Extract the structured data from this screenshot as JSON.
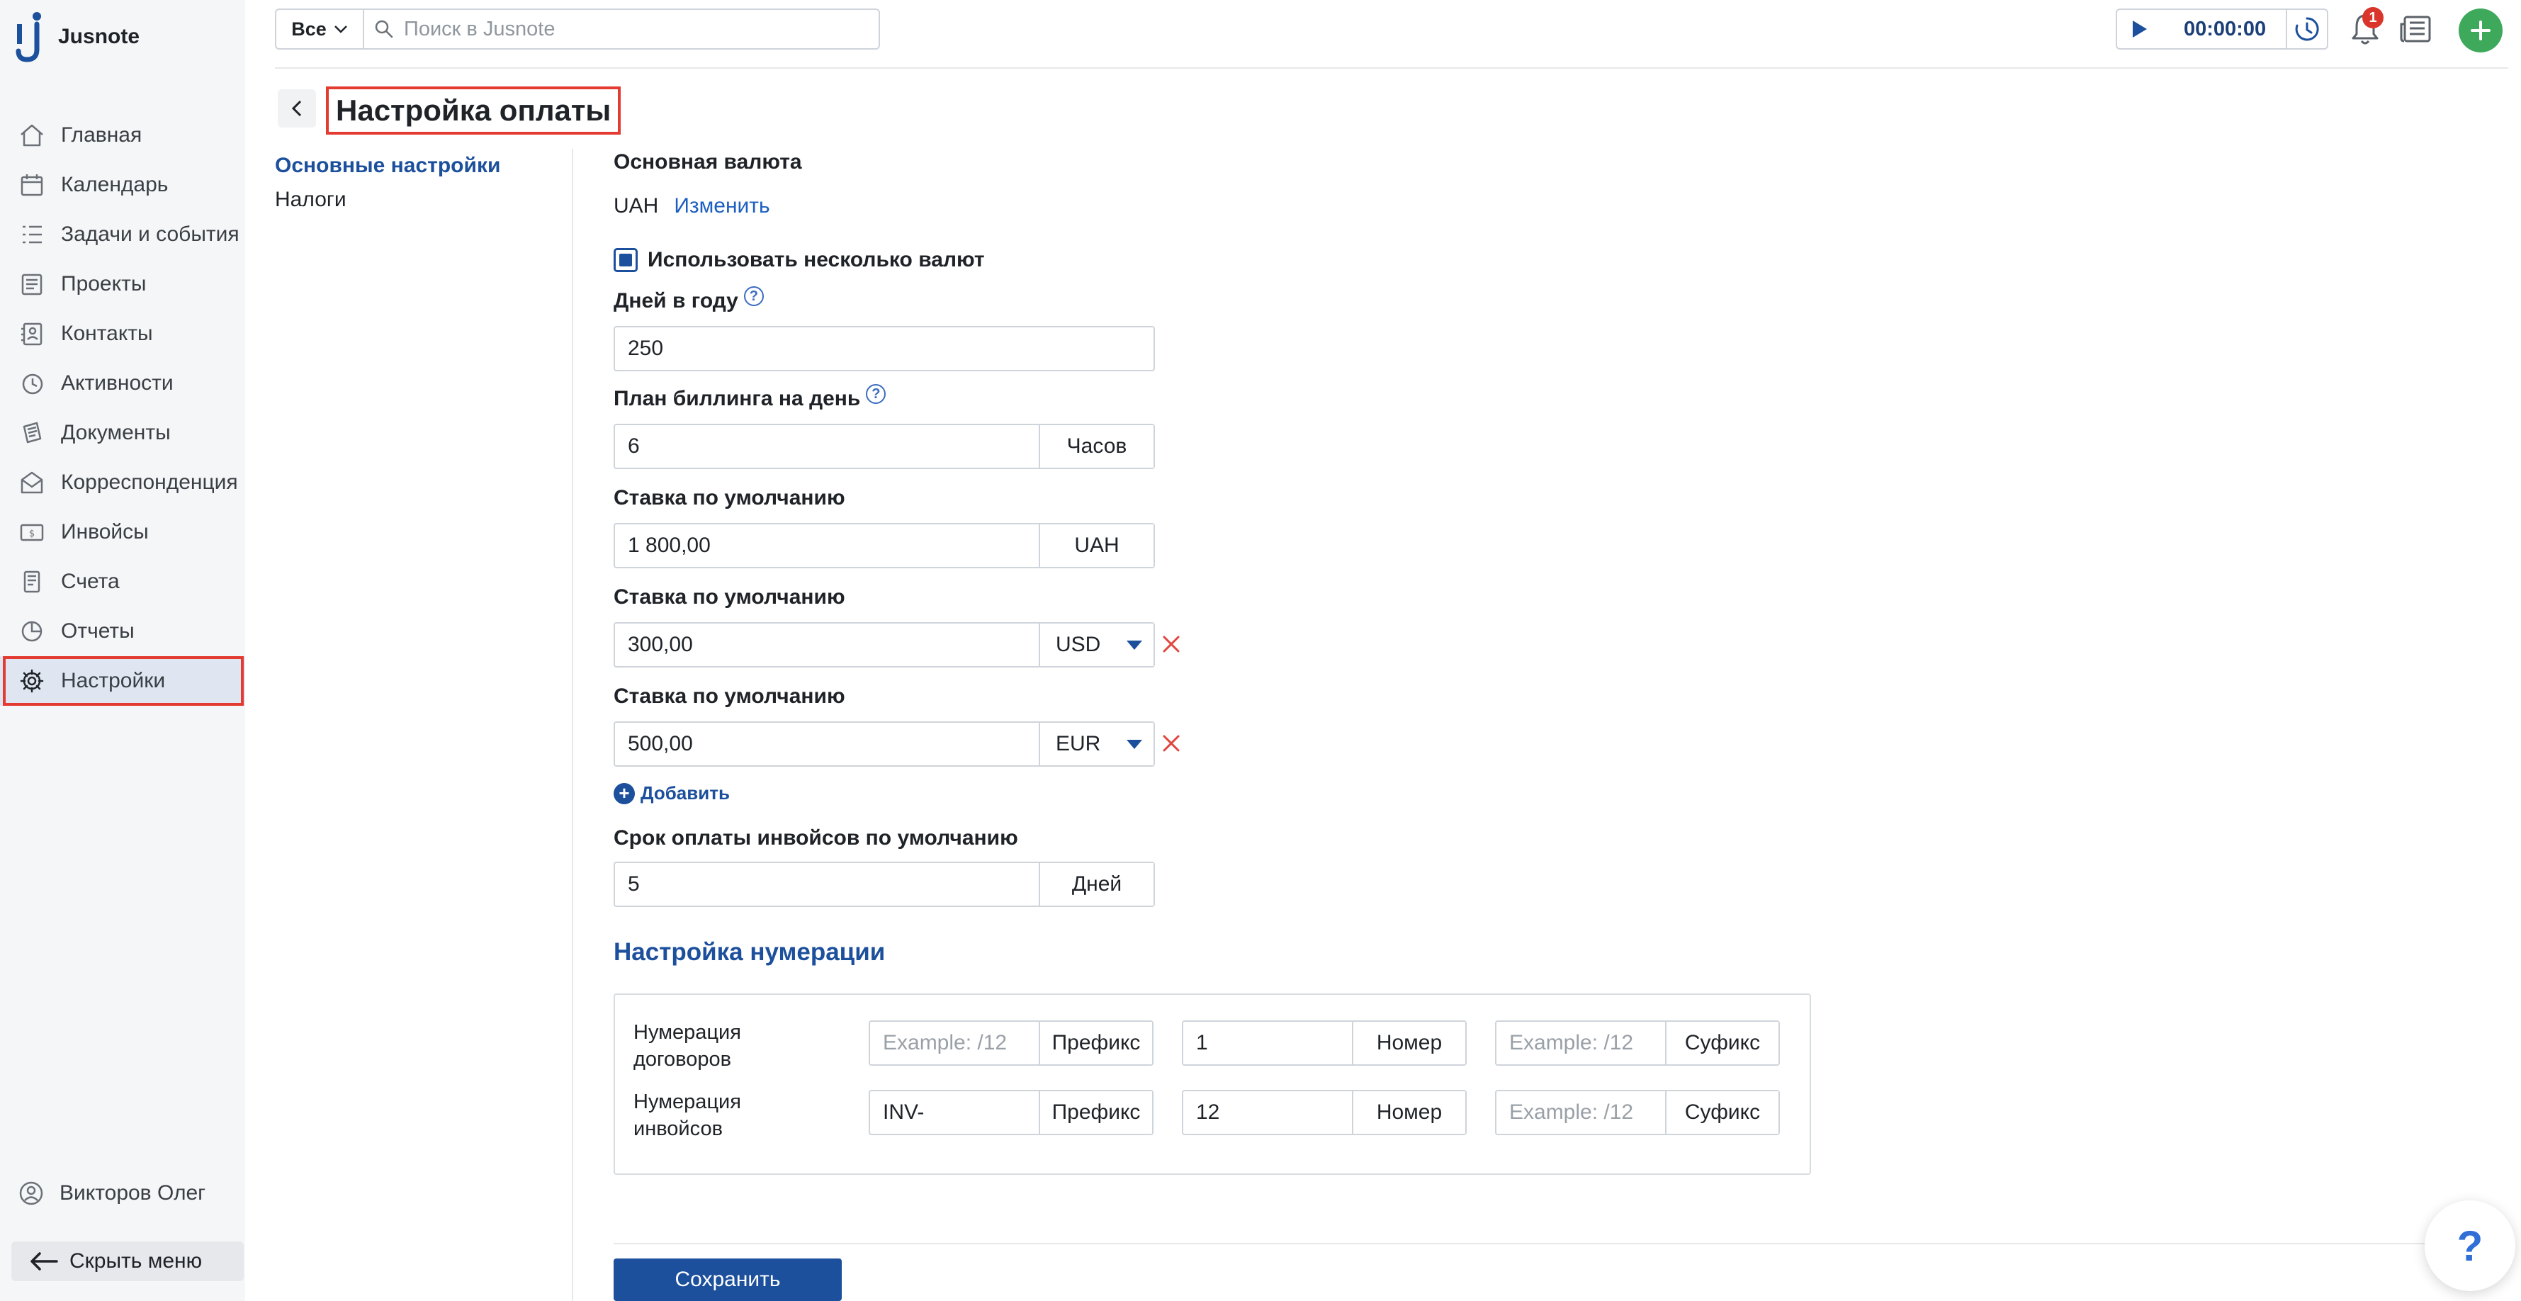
{
  "app": {
    "logo_text": "Jusnote"
  },
  "sidebar": {
    "items": [
      {
        "label": "Главная",
        "icon": "home-icon"
      },
      {
        "label": "Календарь",
        "icon": "calendar-icon"
      },
      {
        "label": "Задачи и события",
        "icon": "tasks-icon"
      },
      {
        "label": "Проекты",
        "icon": "projects-icon"
      },
      {
        "label": "Контакты",
        "icon": "contacts-icon"
      },
      {
        "label": "Активности",
        "icon": "activity-icon"
      },
      {
        "label": "Документы",
        "icon": "documents-icon"
      },
      {
        "label": "Корреспонденция",
        "icon": "mail-icon"
      },
      {
        "label": "Инвойсы",
        "icon": "invoice-icon"
      },
      {
        "label": "Счета",
        "icon": "bills-icon"
      },
      {
        "label": "Отчеты",
        "icon": "reports-icon"
      },
      {
        "label": "Настройки",
        "icon": "settings-icon"
      }
    ],
    "active_index": 11,
    "user_name": "Викторов Олег",
    "hide_menu_label": "Скрыть меню"
  },
  "topbar": {
    "scope_label": "Все",
    "search_placeholder": "Поиск в Jusnote",
    "timer_value": "00:00:00",
    "notification_count": "1"
  },
  "page": {
    "title": "Настройка оплаты",
    "subnav": [
      "Основные настройки",
      "Налоги"
    ],
    "subnav_active": 0
  },
  "form": {
    "base_currency_label": "Основная валюта",
    "base_currency_value": "UAH",
    "change_link": "Изменить",
    "multi_currency_label": "Использовать несколько валют",
    "multi_currency_checked": true,
    "days_per_year_label": "Дней в году",
    "days_per_year_value": "250",
    "billing_plan_label": "План биллинга на день",
    "billing_plan_value": "6",
    "billing_plan_unit": "Часов",
    "rates": [
      {
        "label": "Ставка по умолчанию",
        "value": "1 800,00",
        "currency": "UAH",
        "removable": false
      },
      {
        "label": "Ставка по умолчанию",
        "value": "300,00",
        "currency": "USD",
        "removable": true
      },
      {
        "label": "Ставка по умолчанию",
        "value": "500,00",
        "currency": "EUR",
        "removable": true
      }
    ],
    "add_label": "Добавить",
    "payment_term_label": "Срок оплаты инвойсов по умолчанию",
    "payment_term_value": "5",
    "payment_term_unit": "Дней"
  },
  "numbering": {
    "title": "Настройка нумерации",
    "rows": [
      {
        "label": "Нумерация договоров",
        "prefix_value": "",
        "prefix_placeholder": "Example: /12",
        "prefix_label": "Префикс",
        "number_value": "1",
        "number_label": "Номер",
        "suffix_value": "",
        "suffix_placeholder": "Example: /12",
        "suffix_label": "Суфикс"
      },
      {
        "label": "Нумерация инвойсов",
        "prefix_value": "INV-",
        "prefix_placeholder": "Example: /12",
        "prefix_label": "Префикс",
        "number_value": "12",
        "number_label": "Номер",
        "suffix_value": "",
        "suffix_placeholder": "Example: /12",
        "suffix_label": "Суфикс"
      }
    ]
  },
  "save_label": "Сохранить",
  "help_label": "?",
  "colors": {
    "primary": "#1c4f9c",
    "highlight": "#e33b32",
    "add_button": "#3ea85b",
    "badge": "#d9352b"
  }
}
